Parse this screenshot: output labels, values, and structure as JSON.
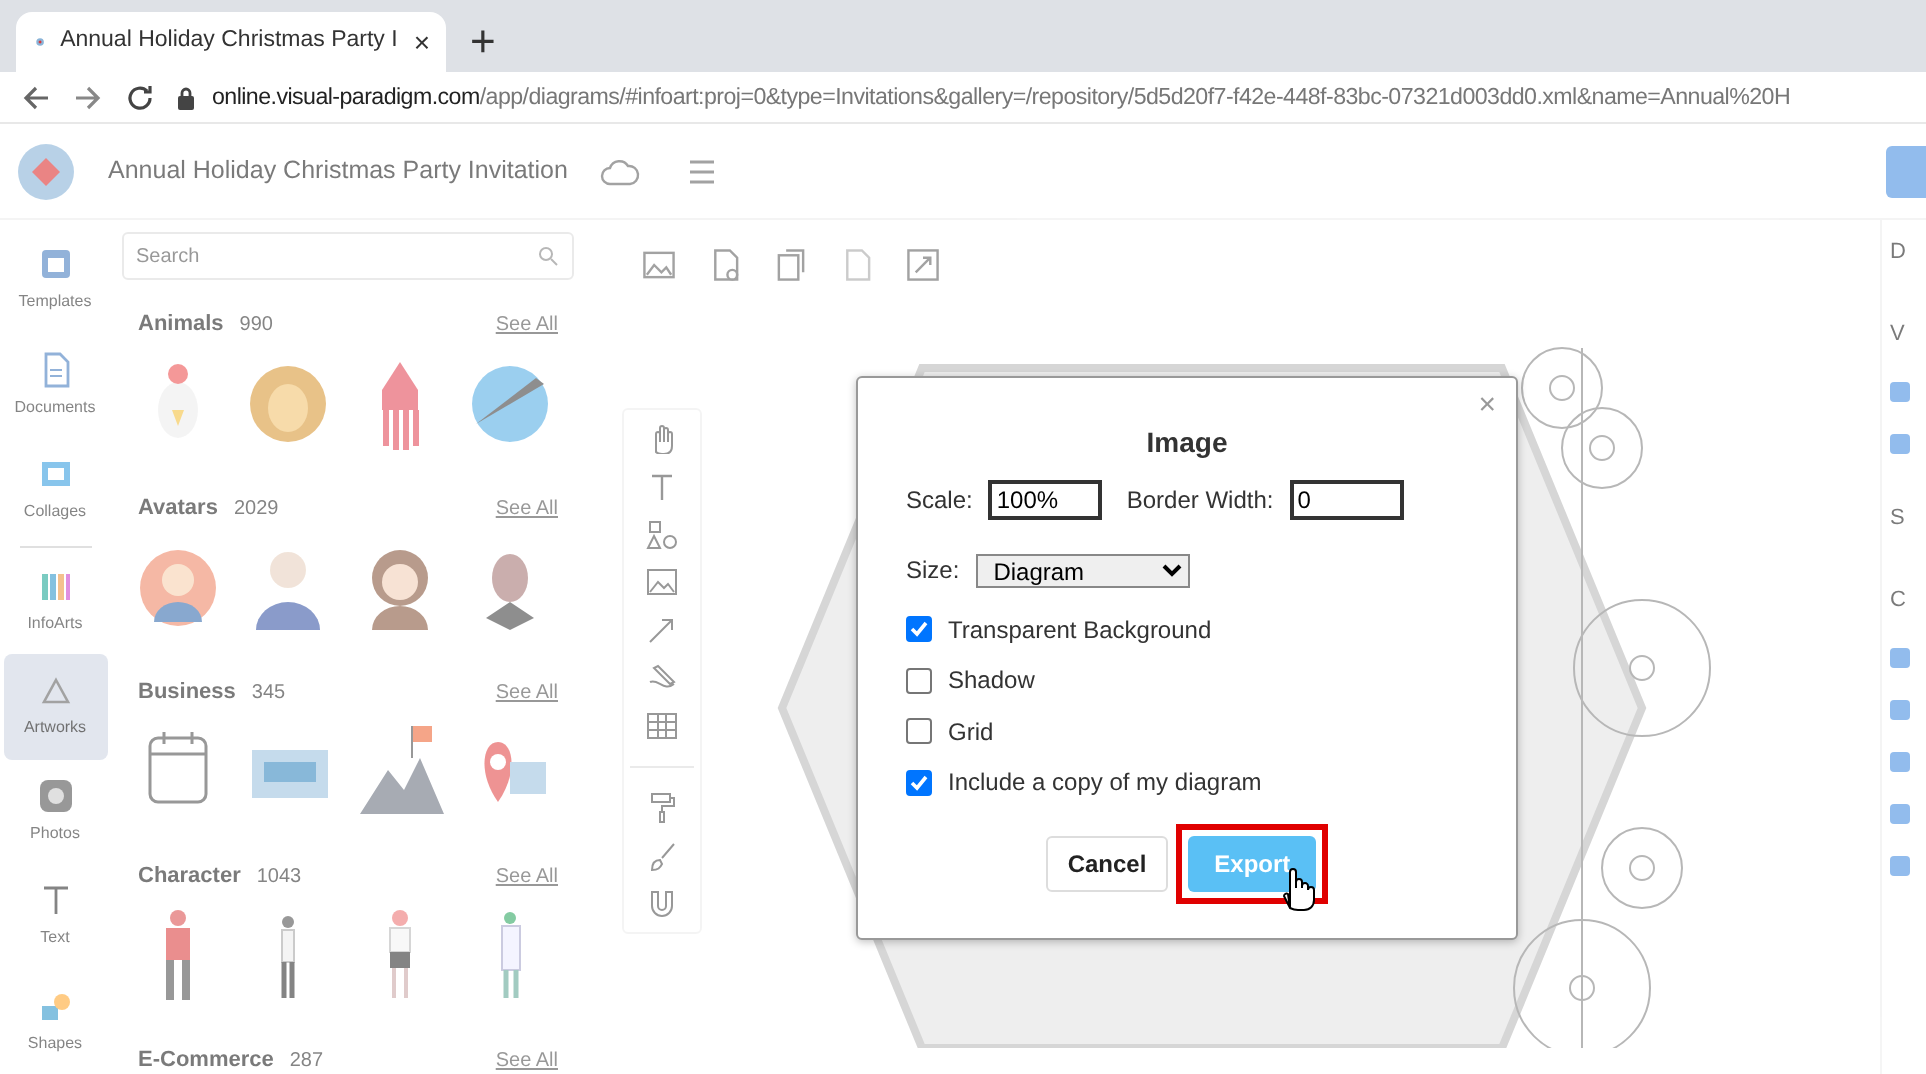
{
  "browser": {
    "tab": {
      "title": "Annual Holiday Christmas Party I",
      "selected": true
    },
    "tab_close": "×",
    "new_tab": "+",
    "url_host": "online.visual-paradigm.com",
    "url_path": "/app/diagrams/#infoart:proj=0&type=Invitations&gallery=/repository/5d5d20f7-f42e-448f-83bc-07321d003dd0.xml&name=Annual%20H"
  },
  "app": {
    "title": "Annual Holiday Christmas Party Invitation"
  },
  "nav_rail": [
    {
      "label": "Templates",
      "selected": false
    },
    {
      "label": "Documents",
      "selected": false
    },
    {
      "label": "Collages",
      "selected": false
    },
    {
      "label": "InfoArts",
      "selected": false
    },
    {
      "label": "Artworks",
      "selected": true
    },
    {
      "label": "Photos",
      "selected": false
    },
    {
      "label": "Text",
      "selected": false
    },
    {
      "label": "Shapes",
      "selected": false
    }
  ],
  "panel": {
    "search": {
      "placeholder": "Search"
    },
    "categories": [
      {
        "name": "Animals",
        "count": "990",
        "see_all": "See All"
      },
      {
        "name": "Avatars",
        "count": "2029",
        "see_all": "See All"
      },
      {
        "name": "Business",
        "count": "345",
        "see_all": "See All"
      },
      {
        "name": "Character",
        "count": "1043",
        "see_all": "See All"
      },
      {
        "name": "E-Commerce",
        "count": "287",
        "see_all": "See All"
      }
    ]
  },
  "right_panel": {
    "heading": "D",
    "sections": [
      {
        "label": "V",
        "options": [
          {
            "checked": true
          },
          {
            "checked": true
          }
        ]
      },
      {
        "label": "S"
      },
      {
        "label": "C",
        "options": [
          {
            "checked": true
          },
          {
            "checked": true
          },
          {
            "checked": true
          },
          {
            "checked": true
          },
          {
            "checked": true
          }
        ]
      }
    ]
  },
  "dialog": {
    "title": "Image",
    "close": "×",
    "fields": [
      {
        "label": "Scale:",
        "value": "100%"
      },
      {
        "label": "Border Width:",
        "value": "0"
      }
    ],
    "size": {
      "label": "Size:",
      "value": "Diagram"
    },
    "options": [
      {
        "label": "Transparent Background",
        "checked": true
      },
      {
        "label": "Shadow",
        "checked": false
      },
      {
        "label": "Grid",
        "checked": false
      },
      {
        "label": "Include a copy of my diagram",
        "checked": true
      }
    ],
    "buttons": [
      {
        "label": "Cancel",
        "kind": "secondary",
        "highlighted": false
      },
      {
        "label": "Export",
        "kind": "primary",
        "highlighted": true
      }
    ]
  }
}
